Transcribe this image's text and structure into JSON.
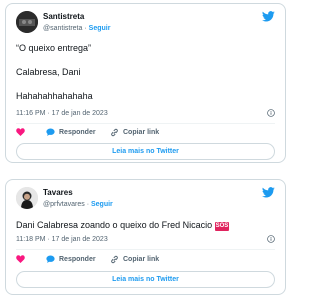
{
  "tweets": [
    {
      "author": {
        "display_name": "Santistreta",
        "handle": "@santistreta",
        "follow_label": "Seguir"
      },
      "lines": [
        "“O queixo entrega”",
        "Calabresa, Dani",
        "Hahahahhahahaha"
      ],
      "timestamp": "11:16 PM · 17 de jan de 2023",
      "actions": {
        "reply_label": "Responder",
        "copy_label": "Copiar link"
      },
      "read_more_label": "Leia mais no Twitter"
    },
    {
      "author": {
        "display_name": "Tavares",
        "handle": "@prfvtavares",
        "follow_label": "Seguir"
      },
      "text": "Dani Calabresa zoando o queixo do Fred Nicacio",
      "emoji_label": "SOS",
      "timestamp": "11:18 PM · 17 de jan de 2023",
      "actions": {
        "reply_label": "Responder",
        "copy_label": "Copiar link"
      },
      "read_more_label": "Leia mais no Twitter"
    }
  ],
  "icons": {
    "brand": "twitter-bird-icon",
    "like": "heart-icon",
    "reply": "speech-bubble-icon",
    "copy": "link-icon",
    "info": "info-icon"
  },
  "colors": {
    "twitter_blue": "#1d9bf0",
    "like_red": "#f91880",
    "sos_red": "#e0245e",
    "border": "#cfd9de",
    "muted": "#536471"
  }
}
